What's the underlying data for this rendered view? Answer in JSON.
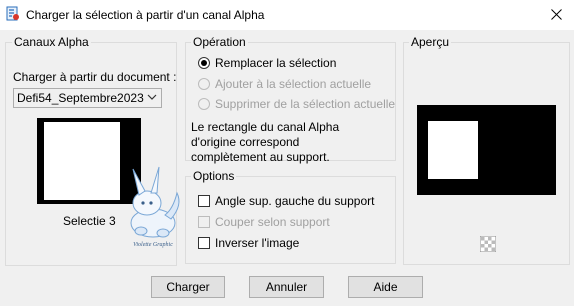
{
  "window": {
    "title": "Charger la sélection à partir d'un canal Alpha"
  },
  "channels_group": {
    "legend": "Canaux Alpha",
    "load_from_label": "Charger à partir du document :",
    "document_value": "Defi54_Septembre2023",
    "selection_name": "Selectie 3",
    "watermark_text": "Violette Graphic"
  },
  "operation_group": {
    "legend": "Opération",
    "options": [
      {
        "label": "Remplacer la sélection",
        "checked": true,
        "enabled": true
      },
      {
        "label": "Ajouter à la sélection actuelle",
        "checked": false,
        "enabled": false
      },
      {
        "label": "Supprimer de la sélection actuelle",
        "checked": false,
        "enabled": false
      }
    ],
    "info_lines": [
      "Le rectangle du canal Alpha",
      "d'origine correspond",
      "complètement au support."
    ]
  },
  "options_group": {
    "legend": "Options",
    "checkboxes": [
      {
        "label": "Angle sup. gauche du support",
        "checked": false,
        "enabled": true
      },
      {
        "label": "Couper selon support",
        "checked": false,
        "enabled": false
      },
      {
        "label": "Inverser l'image",
        "checked": false,
        "enabled": true
      }
    ]
  },
  "preview_group": {
    "legend": "Aperçu"
  },
  "buttons": {
    "load": "Charger",
    "cancel": "Annuler",
    "help": "Aide"
  }
}
